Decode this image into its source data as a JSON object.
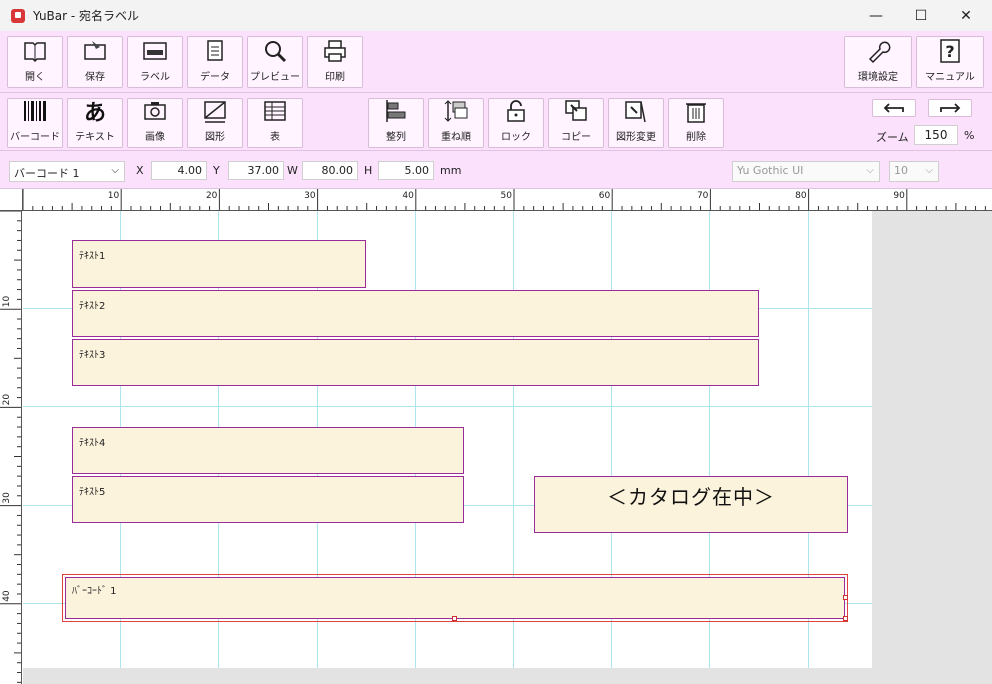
{
  "window": {
    "title": "YuBar - 宛名ラベル",
    "minimize": "—",
    "maximize": "☐",
    "close": "✕"
  },
  "toolbar1": {
    "open": "開く",
    "save": "保存",
    "label": "ラベル",
    "data": "データ",
    "preview": "プレビュー",
    "print": "印刷",
    "env_settings": "環境設定",
    "manual": "マニュアル"
  },
  "toolbar2": {
    "barcode": "バーコード",
    "text": "テキスト",
    "image": "画像",
    "shape": "図形",
    "table": "表",
    "align": "整列",
    "order": "重ね順",
    "lock": "ロック",
    "copy": "コピー",
    "shape_change": "図形変更",
    "delete": "削除",
    "zoom_label": "ズーム",
    "zoom_value": "150",
    "zoom_unit": "%",
    "text_glyph": "あ"
  },
  "propbar": {
    "object_select": "バーコード 1",
    "x_label": "X",
    "x_value": "4.00",
    "y_label": "Y",
    "y_value": "37.00",
    "w_label": "W",
    "w_value": "80.00",
    "h_label": "H",
    "h_value": "5.00",
    "unit": "mm",
    "font_name": "Yu Gothic UI",
    "font_size": "10"
  },
  "ruler": {
    "top_labels": [
      "10",
      "20",
      "30",
      "40",
      "50",
      "60",
      "70",
      "80",
      "90"
    ],
    "left_labels": [
      "10",
      "20",
      "30",
      "40"
    ]
  },
  "objects": {
    "text1": "ﾃｷｽﾄ1",
    "text2": "ﾃｷｽﾄ2",
    "text3": "ﾃｷｽﾄ3",
    "text4": "ﾃｷｽﾄ4",
    "text5": "ﾃｷｽﾄ5",
    "catalog": "＜カタログ在中＞",
    "barcode1": "ﾊﾞｰｺｰﾄﾞ 1"
  },
  "colors": {
    "toolbar_bg": "#fbe1fb",
    "object_fill": "#fcf3dc",
    "object_border": "#9a2c9a",
    "grid": "#aee4ee",
    "selection": "#e04040"
  }
}
